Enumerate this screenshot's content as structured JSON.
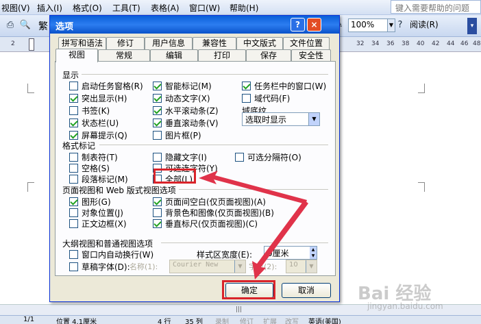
{
  "menubar": {
    "items": [
      "视图(V)",
      "插入(I)",
      "格式(O)",
      "工具(T)",
      "表格(A)",
      "窗口(W)",
      "帮助(H)"
    ],
    "help_placeholder": "键入需要帮助的问题"
  },
  "toolbar": {
    "font_prefix": "繁",
    "zoom": "100%",
    "read_label": "阅读(R)"
  },
  "ruler": {
    "left_mark": "2",
    "ticks": [
      "32",
      "34",
      "36",
      "38",
      "40",
      "42",
      "44",
      "46",
      "48"
    ]
  },
  "statusbar": {
    "page": "1/1",
    "position": "位置 4.1厘米",
    "row": "4 行",
    "col": "35 列",
    "rec": "录制",
    "trk": "修订",
    "ext": "扩展",
    "ovr": "改写",
    "lang": "英语(美国)"
  },
  "dialog": {
    "title": "选项",
    "help_btn": "?",
    "close_btn": "×",
    "tabs_row1": [
      "拼写和语法",
      "修订",
      "用户信息",
      "兼容性",
      "中文版式",
      "文件位置"
    ],
    "tabs_row2": [
      "视图",
      "常规",
      "编辑",
      "打印",
      "保存",
      "安全性"
    ],
    "display": {
      "heading": "显示",
      "col1": [
        {
          "label": "启动任务窗格(R)",
          "checked": false
        },
        {
          "label": "突出显示(H)",
          "checked": true
        },
        {
          "label": "书签(K)",
          "checked": false
        },
        {
          "label": "状态栏(U)",
          "checked": true
        },
        {
          "label": "屏幕提示(Q)",
          "checked": true
        }
      ],
      "col2": [
        {
          "label": "智能标记(M)",
          "checked": true
        },
        {
          "label": "动态文字(X)",
          "checked": true
        },
        {
          "label": "水平滚动条(Z)",
          "checked": true
        },
        {
          "label": "垂直滚动条(V)",
          "checked": true
        },
        {
          "label": "图片框(P)",
          "checked": false
        }
      ],
      "col3": [
        {
          "label": "任务栏中的窗口(W)",
          "checked": true
        },
        {
          "label": "域代码(F)",
          "checked": false
        }
      ],
      "field_shading_label": "域底纹_",
      "field_shading_value": "选取时显示"
    },
    "formatting": {
      "heading": "格式标记",
      "col1": [
        {
          "label": "制表符(T)",
          "checked": false
        },
        {
          "label": "空格(S)",
          "checked": false
        },
        {
          "label": "段落标记(M)",
          "checked": false
        }
      ],
      "col2": [
        {
          "label": "隐藏文字(I)",
          "checked": false
        },
        {
          "label": "可选连字符(Y)",
          "checked": false
        },
        {
          "label": "全部(L)",
          "checked": false
        }
      ],
      "col3": [
        {
          "label": "可选分隔符(O)",
          "checked": false
        }
      ]
    },
    "print_web": {
      "heading": "页面视图和 Web 版式视图选项",
      "col1": [
        {
          "label": "图形(G)",
          "checked": true
        },
        {
          "label": "对象位置(J)",
          "checked": false
        },
        {
          "label": "正文边框(X)",
          "checked": false
        }
      ],
      "col2": [
        {
          "label": "页面间空白(仅页面视图)(A)",
          "checked": true
        },
        {
          "label": "背景色和图像(仅页面视图)(B)",
          "checked": false
        },
        {
          "label": "垂直标尺(仅页面视图)(C)",
          "checked": true
        }
      ]
    },
    "outline": {
      "heading": "大纲视图和普通视图选项",
      "wrap_label": "窗口内自动换行(W)",
      "draft_font_label": "草稿字体(D):",
      "name_label": "名称(1):",
      "name_value": "Courier New",
      "style_width_label": "样式区宽度(E):",
      "style_width_value": "0厘米",
      "size_label": "字号(2):",
      "size_value": "10"
    },
    "ok": "确定",
    "cancel": "取消"
  },
  "watermark": {
    "text": "Bai 经验",
    "url": "jingyan.baidu.com"
  }
}
